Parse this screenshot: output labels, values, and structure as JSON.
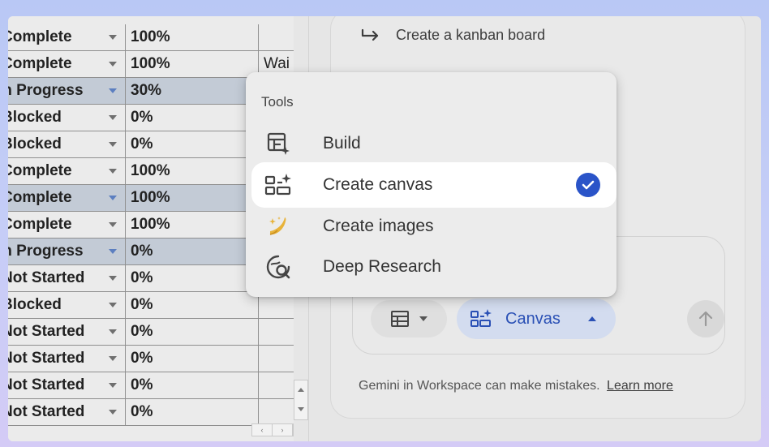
{
  "sheet": {
    "rows": [
      {
        "status": "Complete",
        "pct": "100%",
        "note": ""
      },
      {
        "status": "Complete",
        "pct": "100%",
        "note": "Wai"
      },
      {
        "status": "In Progress",
        "pct": "30%",
        "note": ""
      },
      {
        "status": "Blocked",
        "pct": "0%",
        "note": ""
      },
      {
        "status": "Blocked",
        "pct": "0%",
        "note": ""
      },
      {
        "status": "Complete",
        "pct": "100%",
        "note": ""
      },
      {
        "status": "Complete",
        "pct": "100%",
        "note": ""
      },
      {
        "status": "Complete",
        "pct": "100%",
        "note": ""
      },
      {
        "status": "In Progress",
        "pct": "0%",
        "note": ""
      },
      {
        "status": "Not Started",
        "pct": "0%",
        "note": ""
      },
      {
        "status": "Blocked",
        "pct": "0%",
        "note": ""
      },
      {
        "status": "Not Started",
        "pct": "0%",
        "note": ""
      },
      {
        "status": "Not Started",
        "pct": "0%",
        "note": ""
      },
      {
        "status": "Not Started",
        "pct": "0%",
        "note": ""
      },
      {
        "status": "Not Started",
        "pct": "0%",
        "note": ""
      }
    ],
    "highlighted_rows": [
      2,
      6,
      8
    ],
    "scroll_left": "‹",
    "scroll_right": "›"
  },
  "panel": {
    "suggestion": "Create a kanban board",
    "canvas_chip": "Canvas",
    "disclaimer": "Gemini in Workspace can make mistakes.",
    "learn_more": "Learn more"
  },
  "tools_menu": {
    "title": "Tools",
    "items": [
      {
        "label": "Build",
        "icon": "build-icon",
        "selected": false
      },
      {
        "label": "Create canvas",
        "icon": "canvas-icon",
        "selected": true
      },
      {
        "label": "Create images",
        "icon": "banana-icon",
        "selected": false
      },
      {
        "label": "Deep Research",
        "icon": "deep-research-icon",
        "selected": false
      }
    ]
  },
  "colors": {
    "accent": "#2a54c8",
    "row_highlight": "#c3cbd6",
    "chip_bg": "#d3dcef"
  }
}
